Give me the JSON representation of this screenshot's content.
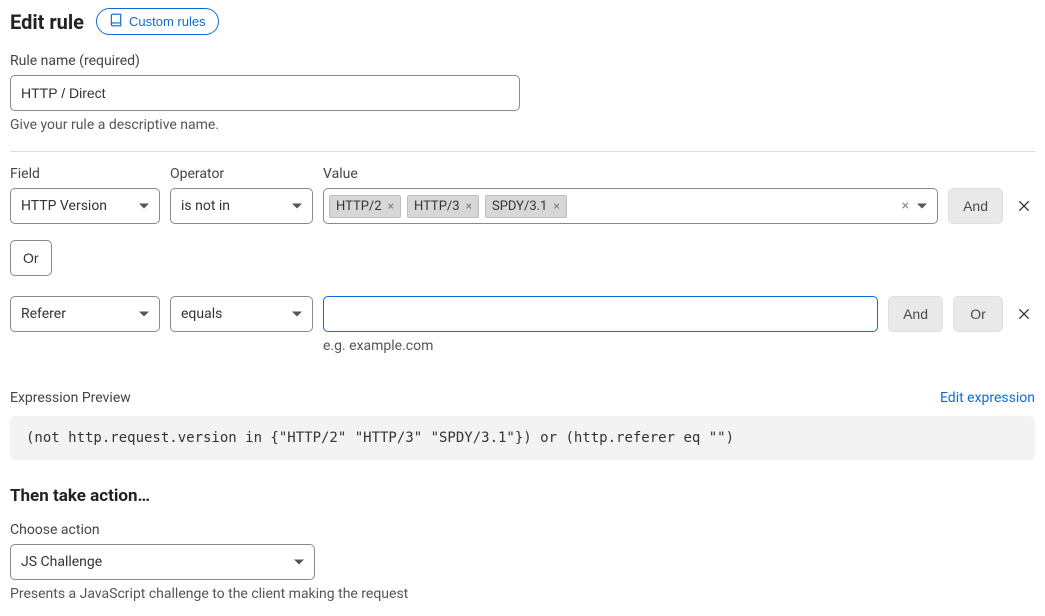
{
  "header": {
    "title": "Edit rule",
    "custom_rules_button": "Custom rules"
  },
  "rule_name": {
    "label": "Rule name (required)",
    "value": "HTTP / Direct",
    "helper": "Give your rule a descriptive name."
  },
  "builder": {
    "labels": {
      "field": "Field",
      "operator": "Operator",
      "value": "Value"
    },
    "row1": {
      "field": "HTTP Version",
      "operator": "is not in",
      "tags": [
        "HTTP/2",
        "HTTP/3",
        "SPDY/3.1"
      ],
      "and_btn": "And"
    },
    "or_separator": "Or",
    "row2": {
      "field": "Referer",
      "operator": "equals",
      "value": "",
      "helper": "e.g. example.com",
      "and_btn": "And",
      "or_btn": "Or"
    }
  },
  "preview": {
    "label": "Expression Preview",
    "edit_link": "Edit expression",
    "expression": "(not http.request.version in {\"HTTP/2\" \"HTTP/3\" \"SPDY/3.1\"}) or (http.referer eq \"\")"
  },
  "action": {
    "title": "Then take action…",
    "label": "Choose action",
    "value": "JS Challenge",
    "helper": "Presents a JavaScript challenge to the client making the request"
  }
}
